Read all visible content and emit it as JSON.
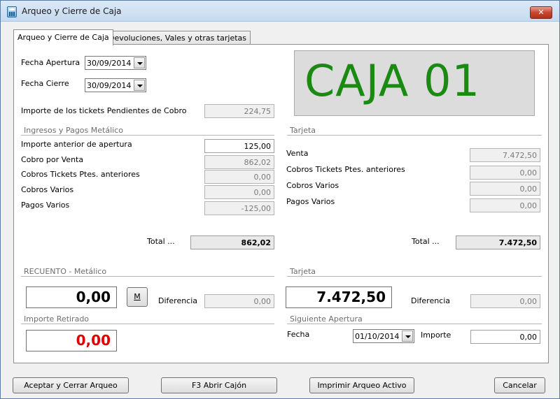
{
  "window": {
    "title": "Arqueo y Cierre de Caja",
    "close_label": "✕"
  },
  "tabs": [
    {
      "label": "Arqueo y Cierre de Caja"
    },
    {
      "label": "Devoluciones, Vales y otras tarjetas"
    }
  ],
  "header": {
    "fecha_apertura_label": "Fecha Apertura",
    "fecha_apertura_value": "30/09/2014",
    "fecha_cierre_label": "Fecha Cierre",
    "fecha_cierre_value": "30/09/2014",
    "pendientes_label": "Importe de los tickets Pendientes de Cobro",
    "pendientes_value": "224,75",
    "caja_display": "CAJA 01"
  },
  "metalico": {
    "section_label": "Ingresos y Pagos Metálico",
    "rows": [
      {
        "label": "Importe anterior de apertura",
        "value": "125,00"
      },
      {
        "label": "Cobro por Venta",
        "value": "862,02"
      },
      {
        "label": "Cobros Tickets Ptes. anteriores",
        "value": "0,00"
      },
      {
        "label": "Cobros Varios",
        "value": "0,00"
      },
      {
        "label": "Pagos Varios",
        "value": "-125,00"
      }
    ],
    "total_label": "Total ...",
    "total_value": "862,02"
  },
  "tarjeta": {
    "section_label": "Tarjeta",
    "rows": [
      {
        "label": "Venta",
        "value": "7.472,50"
      },
      {
        "label": "Cobros Tickets Ptes. anteriores",
        "value": "0,00"
      },
      {
        "label": "Cobros Varios",
        "value": "0,00"
      },
      {
        "label": "Pagos Varios",
        "value": "0,00"
      }
    ],
    "total_label": "Total ...",
    "total_value": "7.472,50"
  },
  "recuento": {
    "section_label": "RECUENTO - Metálico",
    "value": "0,00",
    "m_button": "M",
    "diferencia_label": "Diferencia",
    "diferencia_value": "0,00"
  },
  "recuento_tarjeta": {
    "section_label": "Tarjeta",
    "value": "7.472,50",
    "diferencia_label": "Diferencia",
    "diferencia_value": "0,00"
  },
  "retirado": {
    "section_label": "Importe Retirado",
    "value": "0,00"
  },
  "siguiente": {
    "section_label": "Siguiente Apertura",
    "fecha_label": "Fecha",
    "fecha_value": "01/10/2014",
    "importe_label": "Importe",
    "importe_value": "0,00"
  },
  "buttons": {
    "aceptar": "Aceptar y Cerrar Arqueo",
    "abrir": "F3 Abrir Cajón",
    "imprimir": "Imprimir Arqueo Activo",
    "cancelar": "Cancelar"
  },
  "colors": {
    "caja_text": "#1a8a12",
    "retirado_text": "#e00000"
  }
}
